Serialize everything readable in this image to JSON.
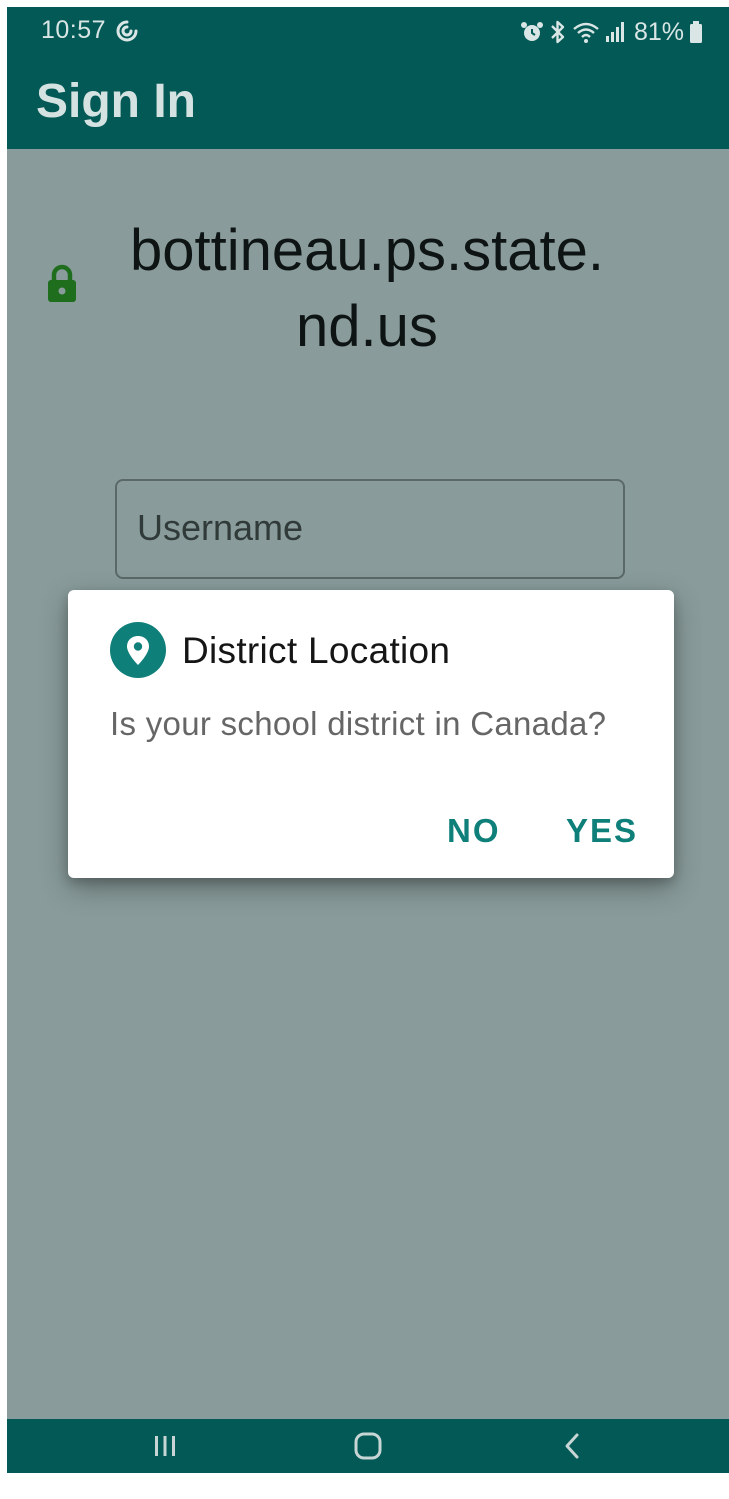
{
  "status_bar": {
    "time": "10:57",
    "sync_icon": "sync-icon",
    "alarm_icon": "alarm-icon",
    "bluetooth_icon": "bluetooth-icon",
    "wifi_icon": "wifi-icon",
    "signal_icon": "signal-icon",
    "battery_percent": "81%",
    "battery_icon": "battery-icon"
  },
  "app_bar": {
    "title": "Sign In"
  },
  "content": {
    "lock_icon": "lock-icon",
    "domain": "bottineau.ps.state.nd.us",
    "username_placeholder": "Username"
  },
  "dialog": {
    "icon": "location-pin-icon",
    "title": "District Location",
    "message": "Is your school district in Canada?",
    "no_label": "NO",
    "yes_label": "YES"
  },
  "nav_bar": {
    "recents_icon": "recents-icon",
    "home_icon": "home-icon",
    "back_icon": "back-icon"
  },
  "colors": {
    "primary": "#025955",
    "scrim_background": "#899c9b",
    "accent": "#0f7f7a",
    "lock": "#1e6e1e"
  }
}
